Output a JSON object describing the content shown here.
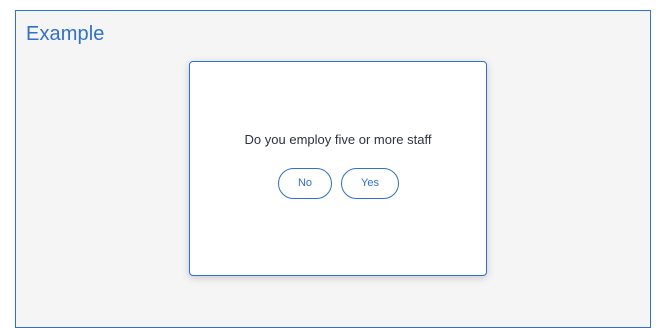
{
  "example": {
    "title": "Example"
  },
  "dialog": {
    "question": "Do you employ five or more staff",
    "buttons": {
      "no_label": "No",
      "yes_label": "Yes"
    }
  },
  "colors": {
    "accent": "#2f6fd6",
    "frame_background": "#f5f5f5",
    "dialog_background": "#ffffff",
    "text": "#2b3440"
  }
}
